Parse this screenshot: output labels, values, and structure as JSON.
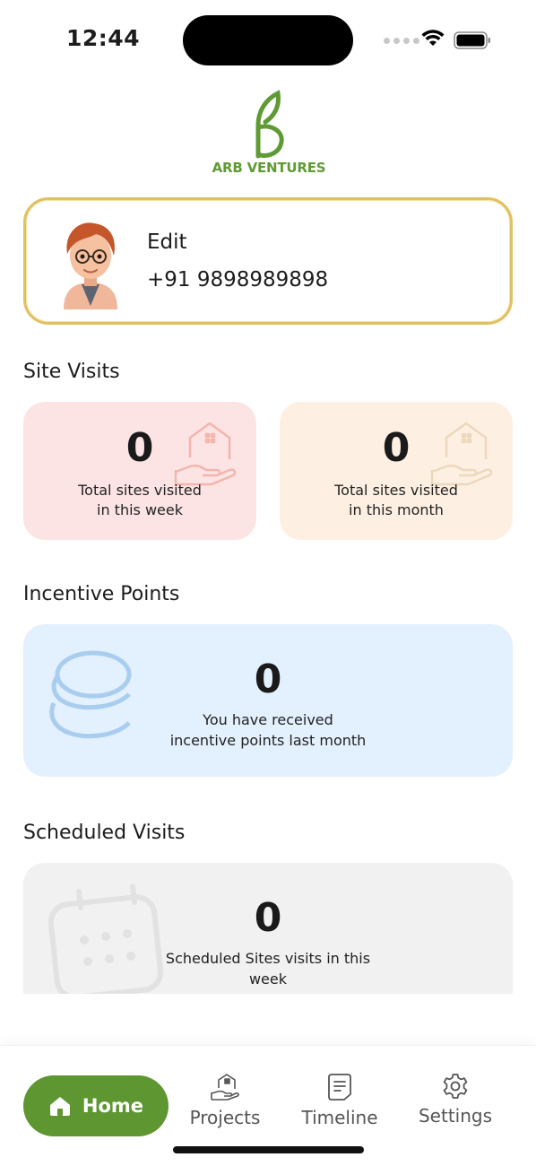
{
  "status_bar": {
    "time": "12:44"
  },
  "brand": {
    "name": "ARB VENTURES",
    "logo_color": "#5f9a35"
  },
  "profile": {
    "name": "Edit",
    "phone": "+91 9898989898",
    "border_color": "#e1c063"
  },
  "site_visits": {
    "title": "Site Visits",
    "week": {
      "value": "0",
      "label_line1": "Total sites visited",
      "label_line2": "in this week",
      "bg": "#fde4e4",
      "icon": "hand-house-icon"
    },
    "month": {
      "value": "0",
      "label_line1": "Total sites visited",
      "label_line2": "in this month",
      "bg": "#fdf0e2",
      "icon": "hand-house-icon"
    }
  },
  "incentive_points": {
    "title": "Incentive Points",
    "value": "0",
    "label_line1": "You have received",
    "label_line2": "incentive points last month",
    "bg": "#e3f0fd",
    "icon": "coins-icon"
  },
  "scheduled_visits": {
    "title": "Scheduled Visits",
    "value": "0",
    "label_line1": "Scheduled Sites visits in this",
    "label_line2": "week",
    "bg": "#f1f1f1",
    "icon": "calendar-icon"
  },
  "nav": {
    "home": "Home",
    "projects": "Projects",
    "timeline": "Timeline",
    "settings": "Settings",
    "active_color": "#5e9632"
  }
}
